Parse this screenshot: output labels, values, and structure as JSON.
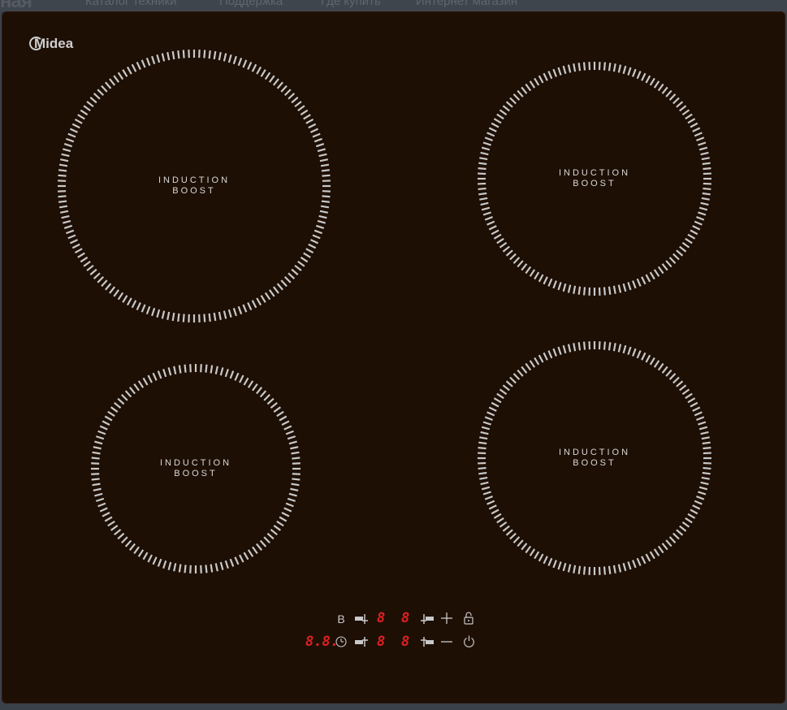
{
  "top_nav": {
    "brand": "ная",
    "items": [
      "Каталог техники",
      "Поддержка",
      "Где купить",
      "Интернет магазин"
    ]
  },
  "cooktop": {
    "brand_logo": "Midea",
    "zones": [
      {
        "line1": "INDUCTION",
        "line2": "BOOST"
      },
      {
        "line1": "INDUCTION",
        "line2": "BOOST"
      },
      {
        "line1": "INDUCTION",
        "line2": "BOOST"
      },
      {
        "line1": "INDUCTION",
        "line2": "BOOST"
      }
    ],
    "controls": {
      "boost_label": "B",
      "timer_display": "8.8.",
      "zone_display_1": "8",
      "zone_display_2": "8",
      "zone_display_3": "8",
      "zone_display_4": "8"
    },
    "colors": {
      "glass": "#1e0f05",
      "ring_marks": "#c8c8c8",
      "display_red": "#e02020"
    },
    "icons": [
      "zone-select-icon",
      "plus-icon",
      "minus-icon",
      "lock-icon",
      "timer-icon",
      "power-icon"
    ]
  }
}
